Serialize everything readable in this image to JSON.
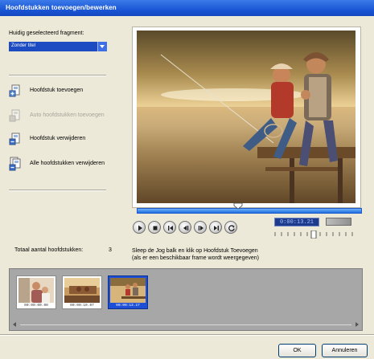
{
  "window": {
    "title": "Hoofdstukken toevoegen/bewerken"
  },
  "fragment": {
    "label": "Huidig geselecteerd fragment:",
    "selected": "Zonder titel"
  },
  "actions": {
    "add": "Hoofdstuk toevoegen",
    "auto_add": "Auto hoofdstukken toevoegen",
    "remove": "Hoofdstuk verwijderen",
    "remove_all": "Alle hoofdstukken verwijderen"
  },
  "player": {
    "timecode": "0:00:13.21",
    "controls": [
      "play-icon",
      "stop-icon",
      "to-start-icon",
      "step-back-icon",
      "step-forward-icon",
      "to-end-icon",
      "repeat-icon"
    ]
  },
  "chapters": {
    "total_label": "Totaal aantal hoofdstukken:",
    "total_count": "3",
    "hint_line1": "Sleep de Jog balk en klik op Hoofdstuk Toevoegen",
    "hint_line2": "(als er een beschikbaar frame wordt weergegeven)",
    "thumbnails": [
      {
        "timecode": "00:00:00.00"
      },
      {
        "timecode": "00:00:10.07"
      },
      {
        "timecode": "00:00:13.17"
      }
    ]
  },
  "buttons": {
    "ok": "OK",
    "cancel": "Annuleren"
  },
  "colors": {
    "title_bar": "#1a56d6",
    "selected_thumb": "#1d4fd6",
    "timeline": "#1f70e0"
  }
}
